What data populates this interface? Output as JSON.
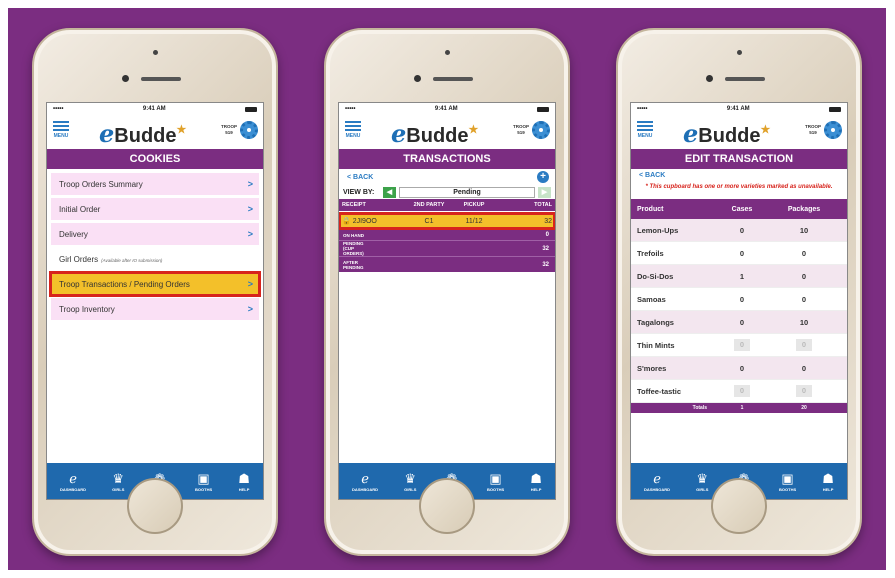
{
  "status": {
    "carrier": "•••••",
    "time": "9:41 AM"
  },
  "header": {
    "menu_label": "MENU",
    "logo_e": "e",
    "logo_text": "Budde",
    "troop_label": "TROOP",
    "troop_number": "519"
  },
  "tabs": [
    {
      "icon": "ℯ",
      "label": "DASHBOARD"
    },
    {
      "icon": "♛",
      "label": "GIRLS"
    },
    {
      "icon": "❁",
      "label": "COOKIES"
    },
    {
      "icon": "▣",
      "label": "BOOTHS"
    },
    {
      "icon": "☗",
      "label": "HELP"
    }
  ],
  "cookies_screen": {
    "title": "COOKIES",
    "items": [
      {
        "label": "Troop Orders Summary",
        "note": ""
      },
      {
        "label": "Initial Order",
        "note": ""
      },
      {
        "label": "Delivery",
        "note": ""
      },
      {
        "label": "Girl Orders",
        "note": "(Available after IO submission)"
      },
      {
        "label": "Troop Transactions / Pending Orders",
        "note": ""
      },
      {
        "label": "Troop Inventory",
        "note": ""
      }
    ]
  },
  "transactions_screen": {
    "title": "TRANSACTIONS",
    "back": "BACK",
    "view_by_label": "VIEW BY:",
    "view_by_value": "Pending",
    "columns": [
      "RECEIPT",
      "2ND PARTY",
      "PICKUP",
      "TOTAL"
    ],
    "row": {
      "receipt": "2JI9OO",
      "party": "C1",
      "pickup": "11/12",
      "total": "32"
    },
    "summary": [
      {
        "label": "ON HAND",
        "value": "0"
      },
      {
        "label": "PENDING (CUP ORDERS)",
        "value": "32"
      },
      {
        "label": "AFTER PENDING",
        "value": "32"
      }
    ]
  },
  "edit_screen": {
    "title": "EDIT TRANSACTION",
    "back": "BACK",
    "warning": "* This cupboard has one or more varieties marked as unavailable.",
    "columns": [
      "Product",
      "Cases",
      "Packages"
    ],
    "rows": [
      {
        "product": "Lemon-Ups",
        "cases": "0",
        "packages": "10",
        "disabled": false
      },
      {
        "product": "Trefoils",
        "cases": "0",
        "packages": "0",
        "disabled": false
      },
      {
        "product": "Do-Si-Dos",
        "cases": "1",
        "packages": "0",
        "disabled": false
      },
      {
        "product": "Samoas",
        "cases": "0",
        "packages": "0",
        "disabled": false
      },
      {
        "product": "Tagalongs",
        "cases": "0",
        "packages": "10",
        "disabled": false
      },
      {
        "product": "Thin Mints",
        "cases": "0",
        "packages": "0",
        "disabled": true
      },
      {
        "product": "S'mores",
        "cases": "0",
        "packages": "0",
        "disabled": false
      },
      {
        "product": "Toffee-tastic",
        "cases": "0",
        "packages": "0",
        "disabled": true
      }
    ],
    "totals": {
      "label": "Totals",
      "cases": "1",
      "packages": "20"
    }
  },
  "colors": {
    "purple": "#7b2d81",
    "blue": "#1f69ad",
    "highlight": "#f3c02a",
    "red": "#d7241d"
  }
}
